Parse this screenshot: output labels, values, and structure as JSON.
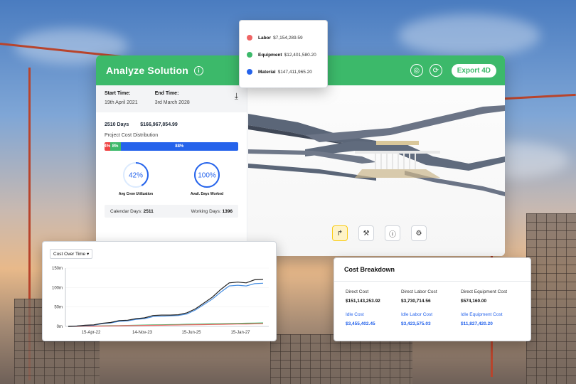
{
  "main": {
    "title": "Analyze Solution",
    "export_label": "Export 4D",
    "start_time_label": "Start Time:",
    "start_time_value": "19th April 2021",
    "end_time_label": "End Time:",
    "end_time_value": "3rd March 2028",
    "duration": "2510 Days",
    "total_cost": "$166,967,854.99",
    "distribution_label": "Project Cost Distribution",
    "distribution": [
      {
        "label": "4%",
        "percent": 4,
        "color": "#ef4444"
      },
      {
        "label": "8%",
        "percent": 8,
        "color": "#3cb96a"
      },
      {
        "label": "88%",
        "percent": 88,
        "color": "#2563eb"
      }
    ],
    "gauges": [
      {
        "value_label": "42%",
        "value": 42,
        "caption": "Avg Crew Utilization"
      },
      {
        "value_label": "100%",
        "value": 100,
        "caption": "Avail. Days Worked"
      }
    ],
    "calendar_days_label": "Calendar Days:",
    "calendar_days_value": "2511",
    "working_days_label": "Working Days:",
    "working_days_value": "1396"
  },
  "legend": [
    {
      "name": "Labor",
      "value": "$7,154,289.59",
      "color": "#ef6464"
    },
    {
      "name": "Equipment",
      "value": "$12,401,580.20",
      "color": "#3cb96a"
    },
    {
      "name": "Material",
      "value": "$147,411,965.20",
      "color": "#2563eb"
    }
  ],
  "chart": {
    "selector_label": "Cost Over Time",
    "selector_caret": "▾"
  },
  "chart_data": {
    "type": "line",
    "x": [
      "15-Apr-22",
      "14-Nov-23",
      "15-Jun-25",
      "15-Jan-27"
    ],
    "xlabel": "",
    "ylabel": "",
    "y_ticks": [
      "0m",
      "50m",
      "100m",
      "150m"
    ],
    "ylim": [
      0,
      150
    ],
    "series": [
      {
        "color": "#222222",
        "values": [
          0,
          1,
          3,
          4,
          8,
          10,
          15,
          16,
          20,
          22,
          28,
          29,
          29,
          30,
          35,
          45,
          60,
          75,
          95,
          112,
          114,
          112,
          120,
          121
        ]
      },
      {
        "color": "#4a90e2",
        "values": [
          0,
          1,
          2,
          3,
          7,
          9,
          13,
          14,
          18,
          20,
          25,
          26,
          27,
          28,
          32,
          42,
          56,
          70,
          88,
          104,
          106,
          104,
          110,
          111
        ]
      },
      {
        "color": "#ef6464",
        "values": [
          0,
          0.2,
          0.5,
          0.8,
          1,
          1.3,
          1.6,
          2,
          2.2,
          2.5,
          2.8,
          3,
          3.3,
          3.6,
          4,
          4.3,
          4.6,
          5,
          5.3,
          5.6,
          6,
          6.3,
          6.6,
          7
        ]
      },
      {
        "color": "#3cb96a",
        "values": [
          0,
          0.3,
          0.7,
          1,
          1.4,
          1.8,
          2.2,
          2.6,
          3,
          3.4,
          3.8,
          4.2,
          4.6,
          5,
          5.4,
          5.8,
          6.2,
          6.6,
          7,
          7.4,
          7.8,
          8.2,
          8.6,
          9
        ]
      }
    ]
  },
  "breakdown": {
    "title": "Cost Breakdown",
    "items": [
      {
        "label": "Direct Cost",
        "value": "$151,143,253.92",
        "idle": false
      },
      {
        "label": "Direct Labor Cost",
        "value": "$3,730,714.56",
        "idle": false
      },
      {
        "label": "Direct Equipment Cost",
        "value": "$574,160.00",
        "idle": false
      },
      {
        "label": "Idle Cost",
        "value": "$3,455,402.45",
        "idle": true
      },
      {
        "label": "Idle Labor Cost",
        "value": "$3,423,575.03",
        "idle": true
      },
      {
        "label": "Idle Equipment Cost",
        "value": "$11,827,420.20",
        "idle": true
      }
    ]
  },
  "icons": {
    "info": "i",
    "download": "⤓",
    "settings_a": "◎",
    "settings_b": "⟳",
    "tool_redo": "↱",
    "tool_crew": "⚒",
    "tool_info": "ⓘ",
    "tool_settings": "⚙"
  }
}
